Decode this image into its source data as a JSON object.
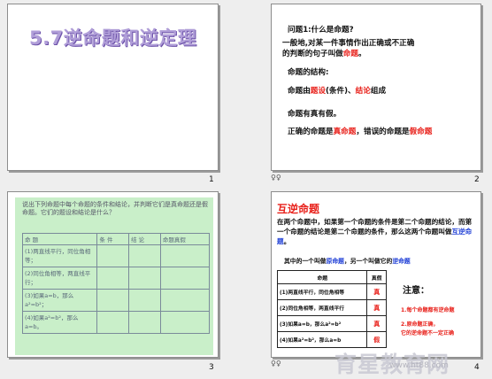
{
  "slides": [
    {
      "number": "1",
      "title": "5.7逆命题和逆定理"
    },
    {
      "number": "2",
      "lines": {
        "q": "问题1:什么是命题?",
        "def1": "一般地,对某一件事情作出正确或不正确",
        "def2_a": "的判断的句子叫做",
        "def2_b": "命题",
        "def2_c": "。",
        "struct": "命题的结构:",
        "comp_a": "命题由",
        "comp_b": "题设",
        "comp_c": "(条件)、",
        "comp_d": "结论",
        "comp_e": "组成",
        "tf": "命题有真有假。",
        "tv_a": "正确的命题是",
        "tv_b": "真命题",
        "tv_c": "，错误的命题是",
        "tv_d": "假命题"
      },
      "mark": "♀♀"
    },
    {
      "number": "3",
      "intro": "说出下列命题中每个命题的条件和结论，并判断它们是真命题还是假命题。它们的题设和结论是什么？",
      "headers": [
        "命  题",
        "条  件",
        "结  论",
        "命题真假"
      ],
      "rows": [
        "(1)两直线平行，同位角相等；",
        "(2)同位角相等，两直线平行；",
        "(3)如果a=b，那么a²=b²；",
        "(4)如果a²=b²，那么a=b。"
      ]
    },
    {
      "number": "4",
      "heading": "互逆命题",
      "para_a": "在两个命题中，如果第一个命题的条件是第二个命题的结论，而第一个命题的结论是第二个命题的条件，那么这两个命题叫做",
      "para_b": "互逆命题",
      "para_c": "。",
      "sub_a": "其中的一个叫做",
      "sub_b": "原命题",
      "sub_c": "，另一个叫做它的",
      "sub_d": "逆命题",
      "headers": [
        "命题",
        "真假"
      ],
      "rows": [
        {
          "text": "(1)两直线平行，同位角相等",
          "value": "真"
        },
        {
          "text": "(2)同位角相等，两直线平行",
          "value": "真"
        },
        {
          "text": "(3)如果a=b，那么a²=b²",
          "value": "真"
        },
        {
          "text": "(4)如果a²=b²，那么a=b",
          "value": "假"
        }
      ],
      "note_title": "注意：",
      "note1": "1.每个命题都有逆命题",
      "note2": "2.原命题正确，",
      "note3": "它的逆命题不一定正确",
      "mark": "♀♀"
    }
  ],
  "watermark": {
    "main": "育星教育网",
    "sub": "www.ht88.com"
  }
}
